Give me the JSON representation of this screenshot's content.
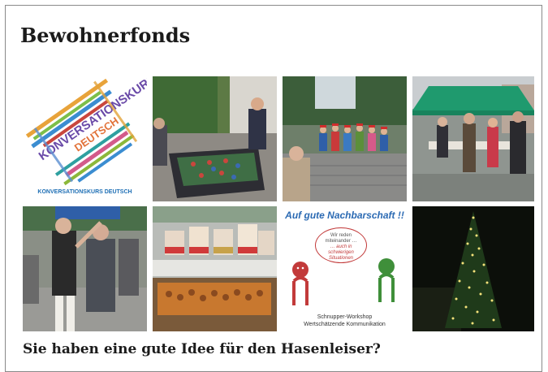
{
  "page": {
    "title": "Bewohnerfonds",
    "subtitle": "Sie haben eine gute Idee für den Hasenleiser?"
  },
  "gallery": {
    "word_cloud": {
      "main_word": "KONVERSATIONSKURS",
      "second_word": "DEUTSCH",
      "caption": "KONVERSATIONSKURS DEUTSCH"
    },
    "neighbourhood": {
      "headline": "Auf gute Nachbarschaft !!",
      "bubble_line1": "Wir reden",
      "bubble_line2": "miteinander …",
      "bubble_line3": "… auch in",
      "bubble_line4": "schwierigen",
      "bubble_line5": "Situationen",
      "footer_line1": "Schnupper-Workshop",
      "footer_line2": "Wertschätzende Kommunikation"
    }
  },
  "colors": {
    "title_text": "#1b1b1b",
    "card_border": "#8a8a8a",
    "accent_blue": "#2b6ab3",
    "accent_red": "#c23a3a",
    "accent_green": "#3f8f3a",
    "tent_green": "#1f9a6e"
  }
}
